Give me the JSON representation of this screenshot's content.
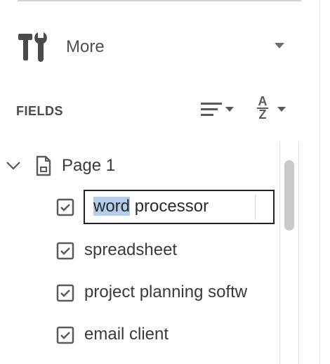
{
  "more": {
    "label": "More",
    "icon": "tools-icon"
  },
  "fields": {
    "title": "FIELDS",
    "sort_icon": "sort-lines-icon",
    "az_top": "A",
    "az_bottom": "Z"
  },
  "tree": {
    "page_label": "Page 1",
    "editing": {
      "selected_part": "word",
      "rest_part": " processor"
    },
    "items": [
      {
        "label": "spreadsheet"
      },
      {
        "label": "project planning softw"
      },
      {
        "label": "email client"
      }
    ]
  }
}
